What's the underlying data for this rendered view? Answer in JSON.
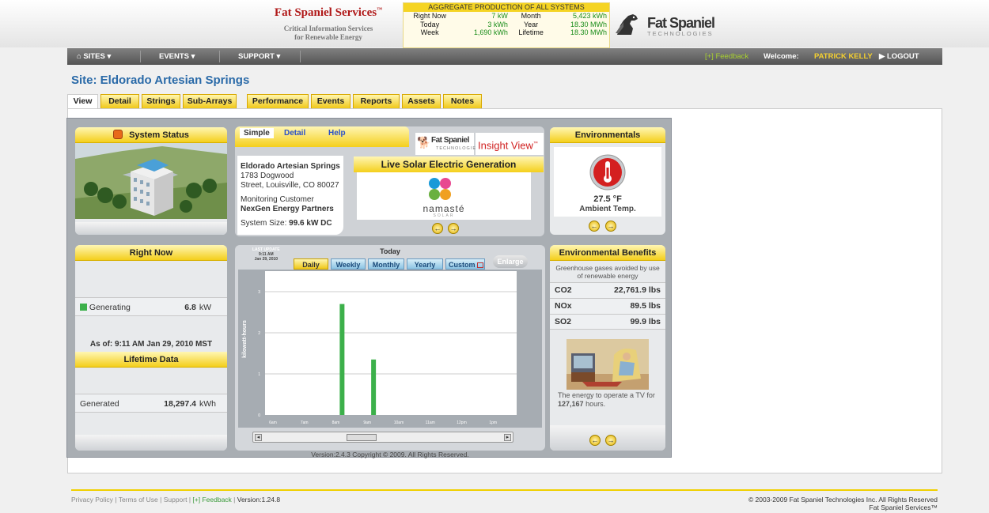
{
  "header": {
    "brand_title": "Fat Spaniel Services",
    "brand_tm": "™",
    "brand_sub1": "Critical Information Services",
    "brand_sub2": "for Renewable Energy",
    "logo_main": "Fat Spaniel",
    "logo_sub": "TECHNOLOGIES"
  },
  "aggregate": {
    "title": "AGGREGATE PRODUCTION OF ALL SYSTEMS",
    "rows": [
      {
        "l1": "Right Now",
        "v1": "7 kW",
        "l2": "Month",
        "v2": "5,423 kWh"
      },
      {
        "l1": "Today",
        "v1": "3 kWh",
        "l2": "Year",
        "v2": "18.30 MWh"
      },
      {
        "l1": "Week",
        "v1": "1,690 kWh",
        "l2": "Lifetime",
        "v2": "18.30 MWh"
      }
    ]
  },
  "nav": {
    "sites": "SITES ▾",
    "events": "EVENTS ▾",
    "support": "SUPPORT ▾",
    "feedback": "[+] Feedback",
    "welcome": "Welcome:",
    "user": "PATRICK KELLY",
    "logout": "LOGOUT"
  },
  "site": {
    "title": "Site: Eldorado Artesian Springs"
  },
  "tabs": [
    "View",
    "Detail",
    "Strings",
    "Sub-Arrays",
    "Performance",
    "Events",
    "Reports",
    "Assets",
    "Notes"
  ],
  "status": {
    "title": "System Status"
  },
  "insight": {
    "tab_simple": "Simple",
    "tab_detail": "Detail",
    "tab_help": "Help",
    "brand": "Fat Spaniel",
    "brand_sub": "TECHNOLOGIES",
    "insight": "Insight View",
    "tm": "™",
    "site_name": "Eldorado Artesian Springs",
    "addr1": "1783 Dogwood",
    "addr2": "Street, Louisville, CO 80027",
    "customer_label": "Monitoring Customer",
    "customer": "NexGen Energy Partners",
    "size_label": "System Size:",
    "size": "99.6 kW DC",
    "live": "Live Solar Electric Generation",
    "partner": "namasté",
    "partner_sub": "SOLAR"
  },
  "environmentals": {
    "title": "Environmentals",
    "temp": "27.5 °F",
    "temp_label": "Ambient Temp."
  },
  "right_now": {
    "title": "Right Now",
    "status": "Generating",
    "value": "6.8",
    "unit": "kW",
    "as_of": "As of: 9:11 AM Jan 29, 2010 MST"
  },
  "lifetime": {
    "title": "Lifetime Data",
    "label": "Generated",
    "value": "18,297.4",
    "unit": "kWh"
  },
  "chart_panel": {
    "last_update_label": "LAST UPDATE",
    "last_update_time": "9:11 AM",
    "last_update_date": "Jan 29, 2010",
    "period": "Today",
    "tabs": [
      "Daily",
      "Weekly",
      "Monthly",
      "Yearly",
      "Custom"
    ],
    "enlarge": "Enlarge",
    "version": "Version:2.4.3  Copyright © 2009. All Rights Reserved."
  },
  "chart_data": {
    "type": "bar",
    "ylabel": "kilowatt-hours",
    "categories": [
      "6am",
      "7am",
      "8am",
      "9am",
      "10am",
      "11am",
      "12pm",
      "1pm"
    ],
    "values": [
      0,
      0,
      2.7,
      1.35,
      0,
      0,
      0,
      0
    ],
    "ylim": [
      0,
      3.5
    ],
    "yticks": [
      0,
      1,
      2,
      3
    ],
    "grid": true,
    "colors": {
      "bar": "#3cb04a"
    }
  },
  "benefits": {
    "title": "Environmental Benefits",
    "intro": "Greenhouse gases avoided by use of renewable energy",
    "items": [
      {
        "label": "CO2",
        "value": "22,761.9 lbs"
      },
      {
        "label": "NOx",
        "value": "89.5 lbs"
      },
      {
        "label": "SO2",
        "value": "99.9 lbs"
      }
    ],
    "tv_text": "The energy to operate a TV for",
    "tv_hours": "127,167",
    "tv_unit": "hours."
  },
  "footer": {
    "privacy": "Privacy Policy",
    "terms": "Terms of Use",
    "support": "Support",
    "feedback": "[+] Feedback",
    "version": "Version:1.24.8",
    "copyright": "© 2003-2009 Fat Spaniel Technologies Inc. All Rights Reserved",
    "product": "Fat Spaniel Services™"
  },
  "colors": {
    "accent": "#f4cf1b",
    "link": "#2a6aa8",
    "green": "#3cb04a"
  }
}
